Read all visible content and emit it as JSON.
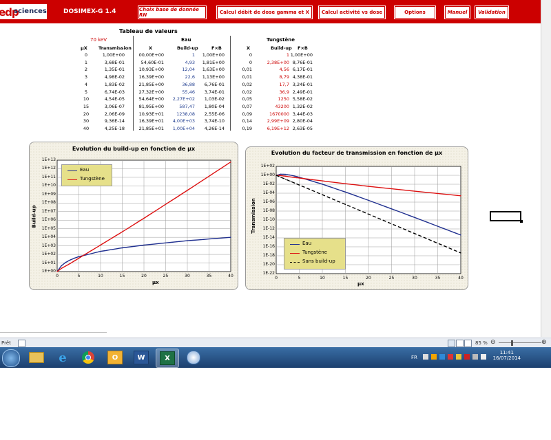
{
  "app": {
    "logo_mark": "edp",
    "logo_text": "sciences",
    "title": "DOSIMEX-G  1.4",
    "buttons": {
      "choix_base": "Choix base de donnée RN",
      "calcul_debit": "Calcul débit de dose gamma et X",
      "calcul_activite": "Calcul activité vs dose",
      "options": "Options",
      "manuel": "Manuel",
      "validation": "Validation"
    }
  },
  "table": {
    "title": "Tableau de valeurs",
    "energy": "70 keV",
    "group_eau": "Eau",
    "group_tungstene": "Tungstène",
    "headers": {
      "mux": "µX",
      "transmission": "Transmission",
      "x_eau": "X",
      "buildup_eau": "Build-up",
      "fxb_eau": "F×B",
      "x_w": "X",
      "buildup_w": "Build-up",
      "fxb_w": "F×B"
    },
    "rows": [
      [
        "0",
        "1,00E+00",
        "00,00E+00",
        "1",
        "1,00E+00",
        "0",
        "1",
        "1,00E+00"
      ],
      [
        "1",
        "3,68E-01",
        "54,60E-01",
        "4,93",
        "1,81E+00",
        "0",
        "2,38E+00",
        "8,76E-01"
      ],
      [
        "2",
        "1,35E-01",
        "10,93E+00",
        "12,04",
        "1,63E+00",
        "0,01",
        "4,56",
        "6,17E-01"
      ],
      [
        "3",
        "4,98E-02",
        "16,39E+00",
        "22,6",
        "1,13E+00",
        "0,01",
        "8,79",
        "4,38E-01"
      ],
      [
        "4",
        "1,83E-02",
        "21,85E+00",
        "36,88",
        "6,76E-01",
        "0,02",
        "17,7",
        "3,24E-01"
      ],
      [
        "5",
        "6,74E-03",
        "27,32E+00",
        "55,46",
        "3,74E-01",
        "0,02",
        "36,9",
        "2,49E-01"
      ],
      [
        "10",
        "4,54E-05",
        "54,64E+00",
        "2,27E+02",
        "1,03E-02",
        "0,05",
        "1250",
        "5,58E-02"
      ],
      [
        "15",
        "3,06E-07",
        "81,95E+00",
        "587,47",
        "1,80E-04",
        "0,07",
        "43200",
        "1,32E-02"
      ],
      [
        "20",
        "2,06E-09",
        "10,93E+01",
        "1238,08",
        "2,55E-06",
        "0,09",
        "1670000",
        "3,44E-03"
      ],
      [
        "30",
        "9,36E-14",
        "16,39E+01",
        "4,00E+03",
        "3,74E-10",
        "0,14",
        "2,99E+09",
        "2,80E-04"
      ],
      [
        "40",
        "4,25E-18",
        "21,85E+01",
        "1,00E+04",
        "4,26E-14",
        "0,19",
        "6,19E+12",
        "2,63E-05"
      ]
    ]
  },
  "chart_data": [
    {
      "type": "line",
      "title": "Evolution du build-up en fonction de µx",
      "xlabel": "µx",
      "ylabel": "Build-up",
      "y_scale": "log",
      "xlim": [
        0,
        40
      ],
      "ylim": [
        1,
        10000000000000.0
      ],
      "x_ticks": [
        "0",
        "5",
        "10",
        "15",
        "20",
        "25",
        "30",
        "35",
        "40"
      ],
      "y_ticks": [
        "1E+00",
        "1E+01",
        "1E+02",
        "1E+03",
        "1E+04",
        "1E+05",
        "1E+06",
        "1E+07",
        "1E+08",
        "1E+09",
        "1E+10",
        "1E+11",
        "1E+12",
        "1E+13"
      ],
      "legend_position": "top-left",
      "x": [
        0,
        1,
        2,
        3,
        4,
        5,
        10,
        15,
        20,
        30,
        40
      ],
      "series": [
        {
          "name": "Eau",
          "color": "#1f2f8f",
          "dash": "",
          "values": [
            1,
            4.93,
            12.04,
            22.6,
            36.88,
            55.46,
            227,
            587.47,
            1238.08,
            4000,
            10000
          ]
        },
        {
          "name": "Tungstène",
          "color": "#dd1111",
          "dash": "",
          "values": [
            1,
            2.38,
            4.56,
            8.79,
            17.7,
            36.9,
            1250,
            43200,
            1670000,
            2990000000,
            6190000000000
          ]
        }
      ]
    },
    {
      "type": "line",
      "title": "Evolution du facteur de transmission en fonction de µx",
      "xlabel": "µx",
      "ylabel": "Transmission",
      "y_scale": "log",
      "xlim": [
        0,
        40
      ],
      "ylim": [
        1e-22,
        100
      ],
      "x_ticks": [
        "0",
        "5",
        "10",
        "15",
        "20",
        "25",
        "30",
        "35",
        "40"
      ],
      "y_ticks": [
        "1E-22",
        "1E-20",
        "1E-18",
        "1E-16",
        "1E-14",
        "1E-12",
        "1E-10",
        "1E-08",
        "1E-06",
        "1E-04",
        "1E-02",
        "1E+00",
        "1E+02"
      ],
      "legend_position": "bottom-left",
      "x": [
        0,
        1,
        2,
        3,
        4,
        5,
        10,
        15,
        20,
        30,
        40
      ],
      "series": [
        {
          "name": "Eau",
          "color": "#1f2f8f",
          "dash": "",
          "values": [
            1,
            1.81,
            1.63,
            1.13,
            0.676,
            0.374,
            0.0103,
            0.00018,
            2.55e-06,
            3.74e-10,
            4.26e-14
          ]
        },
        {
          "name": "Tungstène",
          "color": "#dd1111",
          "dash": "",
          "values": [
            1,
            0.876,
            0.617,
            0.438,
            0.324,
            0.249,
            0.0558,
            0.0132,
            0.00344,
            0.00028,
            2.63e-05
          ]
        },
        {
          "name": "Sans build-up",
          "color": "#000000",
          "dash": "5,3",
          "values": [
            1,
            0.368,
            0.135,
            0.0498,
            0.0183,
            0.00674,
            4.54e-05,
            3.06e-07,
            2.06e-09,
            9.36e-14,
            4.25e-18
          ]
        }
      ]
    }
  ],
  "status": {
    "text": "Prêt",
    "zoom": "85 %"
  },
  "taskbar": {
    "lang": "FR",
    "time": "11:41",
    "date": "16/07/2014"
  }
}
